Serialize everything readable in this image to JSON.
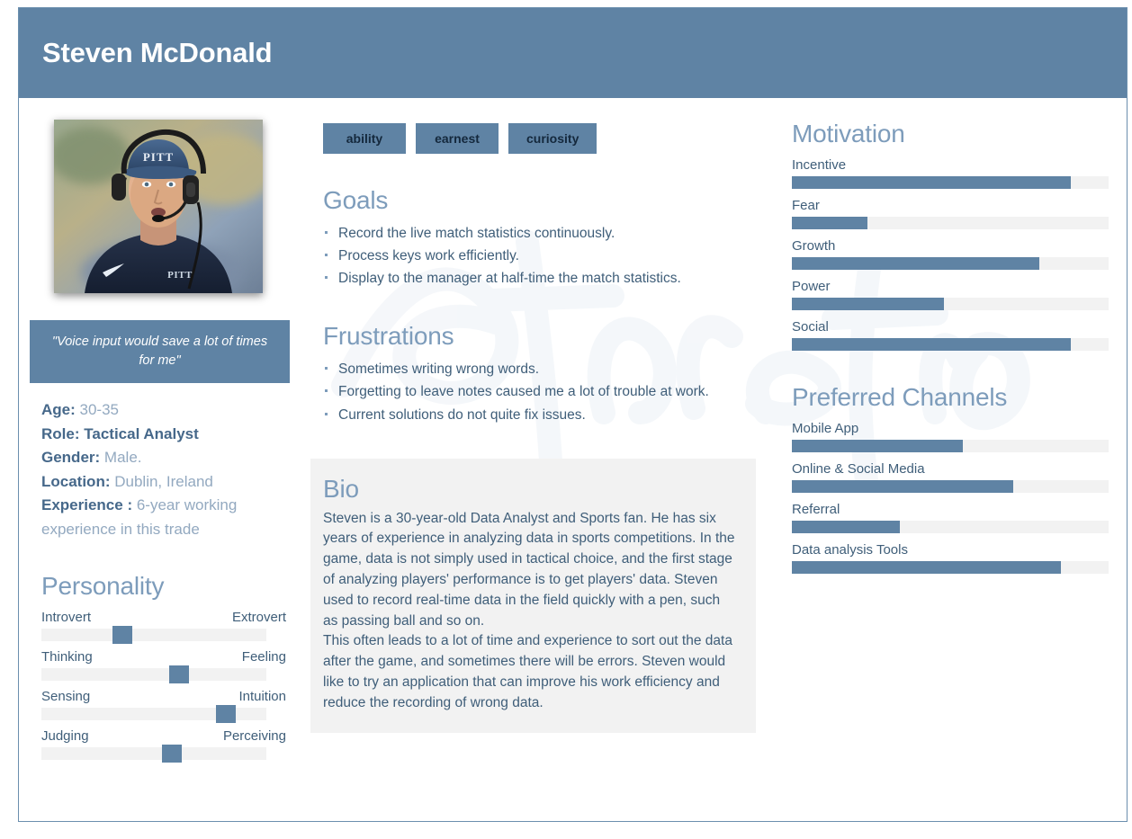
{
  "header": {
    "name": "Steven McDonald"
  },
  "colors": {
    "accent": "#5f83a4",
    "heading": "#7d9cbb",
    "text": "#3f5e79",
    "track": "#f2f2f2",
    "bio_bg": "#f2f2f2",
    "tag_text": "#14283c"
  },
  "photo": {
    "alt": "Portrait of Steven McDonald wearing a PITT cap and coaching headset"
  },
  "quote": {
    "text": "\"Voice input would save a lot of times for me\""
  },
  "facts": [
    {
      "key": "Age:",
      "value": "30-35",
      "strong": false
    },
    {
      "key": "Role",
      "key_suffix": ":",
      "value": "Tactical Analyst",
      "strong": true
    },
    {
      "key": "Gender:",
      "value": "Male.",
      "strong": false
    },
    {
      "key": "Location:",
      "value": "Dublin, Ireland",
      "strong": false
    },
    {
      "key": "Experience :",
      "value": "6-year working experience in this trade",
      "strong": false
    }
  ],
  "personality": {
    "title": "Personality",
    "rows": [
      {
        "left": "Introvert",
        "right": "Extrovert",
        "value": 36
      },
      {
        "left": "Thinking",
        "right": "Feeling",
        "value": 61
      },
      {
        "left": "Sensing",
        "right": "Intuition",
        "value": 82
      },
      {
        "left": "Judging",
        "right": "Perceiving",
        "value": 58
      }
    ]
  },
  "tags": [
    "ability",
    "earnest",
    "curiosity"
  ],
  "goals": {
    "title": "Goals",
    "items": [
      "Record the live match statistics continuously.",
      "Process keys work efficiently.",
      "Display to the manager at half-time the match statistics."
    ]
  },
  "frustrations": {
    "title": "Frustrations",
    "items": [
      "Sometimes writing wrong words.",
      "Forgetting to leave notes caused me a lot of trouble at work.",
      "Current solutions do not quite fix issues."
    ]
  },
  "bio": {
    "title": "Bio",
    "paragraph1": "Steven is a 30-year-old Data Analyst and Sports fan.  He has six years of experience in analyzing data in sports competitions. In the game, data is not simply used in tactical choice, and the first stage of analyzing players' performance is to get players' data. Steven used to record real-time data in the field quickly with a pen, such as passing ball and so on.",
    "paragraph2": "This often leads to a lot of time and experience to sort out the data after the game, and sometimes there will be errors. Steven would like to try an application that can improve his work efficiency and reduce the recording of wrong data."
  },
  "motivation": {
    "title": "Motivation",
    "rows": [
      {
        "label": "Incentive",
        "value": 88
      },
      {
        "label": "Fear",
        "value": 24
      },
      {
        "label": "Growth",
        "value": 78
      },
      {
        "label": "Power",
        "value": 48
      },
      {
        "label": "Social",
        "value": 88
      }
    ]
  },
  "channels": {
    "title": "Preferred Channels",
    "rows": [
      {
        "label": "Mobile App",
        "value": 54
      },
      {
        "label": "Online & Social Media",
        "value": 70
      },
      {
        "label": "Referral",
        "value": 34
      },
      {
        "label": "Data analysis Tools",
        "value": 85
      }
    ]
  },
  "watermark": {
    "text": "Xtensio"
  },
  "chart_data": [
    {
      "type": "bar",
      "title": "Motivation",
      "orientation": "horizontal",
      "categories": [
        "Incentive",
        "Fear",
        "Growth",
        "Power",
        "Social"
      ],
      "values": [
        88,
        24,
        78,
        48,
        88
      ],
      "xlim": [
        0,
        100
      ],
      "grid": false,
      "legend": "none"
    },
    {
      "type": "bar",
      "title": "Preferred Channels",
      "orientation": "horizontal",
      "categories": [
        "Mobile App",
        "Online & Social Media",
        "Referral",
        "Data analysis Tools"
      ],
      "values": [
        54,
        70,
        34,
        85
      ],
      "xlim": [
        0,
        100
      ],
      "grid": false,
      "legend": "none"
    },
    {
      "type": "bar",
      "title": "Personality",
      "orientation": "horizontal",
      "categories": [
        "Introvert–Extrovert",
        "Thinking–Feeling",
        "Sensing–Intuition",
        "Judging–Perceiving"
      ],
      "values": [
        36,
        61,
        82,
        58
      ],
      "xlim": [
        0,
        100
      ],
      "grid": false,
      "legend": "none"
    }
  ]
}
